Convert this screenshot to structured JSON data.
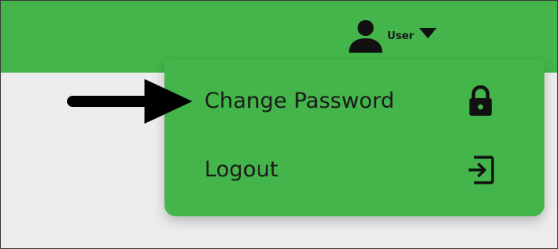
{
  "header": {
    "background_color": "#44b54a",
    "user_menu": {
      "icon": "user-icon",
      "label": "User",
      "caret_icon": "caret-down-icon"
    }
  },
  "dropdown": {
    "background_color": "#44b54a",
    "items": [
      {
        "label": "Change Password",
        "icon": "lock-icon"
      },
      {
        "label": "Logout",
        "icon": "logout-icon"
      }
    ]
  },
  "annotation": {
    "icon": "arrow-right-icon",
    "color": "#000000"
  },
  "page": {
    "background_color": "#ececec"
  }
}
